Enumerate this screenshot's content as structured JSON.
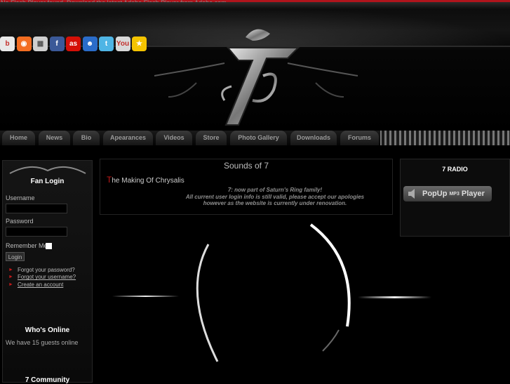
{
  "flash_notice": "No Flash Player found. Download the latest Adobe Flash Player from Adobe.com",
  "social_icons": [
    {
      "name": "blogger",
      "glyph": "b",
      "color": "#e8e8e8",
      "fg": "#c4302b"
    },
    {
      "name": "blog",
      "glyph": "◉",
      "color": "#f36d21",
      "fg": "#fff"
    },
    {
      "name": "delicious",
      "glyph": "▦",
      "color": "#cfcfcf",
      "fg": "#555"
    },
    {
      "name": "facebook",
      "glyph": "f",
      "color": "#3b5998",
      "fg": "#fff"
    },
    {
      "name": "lastfm",
      "glyph": "as",
      "color": "#d51007",
      "fg": "#fff"
    },
    {
      "name": "myspace",
      "glyph": "☻",
      "color": "#2a6cc9",
      "fg": "#fff"
    },
    {
      "name": "twitter",
      "glyph": "t",
      "color": "#4fb5e5",
      "fg": "#fff"
    },
    {
      "name": "youtube",
      "glyph": "You",
      "color": "#d9d9d9",
      "fg": "#c4302b"
    },
    {
      "name": "favorite",
      "glyph": "★",
      "color": "#f5c400",
      "fg": "#fff"
    }
  ],
  "nav": [
    "Home",
    "News",
    "Bio",
    "Apearances",
    "Videos",
    "Store",
    "Photo Gallery",
    "Downloads",
    "Forums"
  ],
  "login": {
    "title": "Fan Login",
    "username_label": "Username",
    "password_label": "Password",
    "remember_label": "Remember Me",
    "button": "Login",
    "links": [
      "Forgot your password?",
      "Forgot your username?",
      "Create an account"
    ]
  },
  "whos_online": {
    "title": "Who's Online",
    "text": "We have 15 guests online"
  },
  "community_title": "7 Community",
  "center": {
    "title": "Sounds of 7",
    "article_first": "T",
    "article_rest": "he Making Of Chrysalis",
    "notice": [
      "7: now part of Saturn's Ring family!",
      "All current user login info is still valid, please accept our apologies",
      "however as the website is currently under renovation."
    ]
  },
  "radio": {
    "title": "7 RADIO",
    "popup_main": "PopUp",
    "popup_small": "MP3",
    "popup_end": "Player"
  },
  "colors": {
    "accent_red": "#c41a1a",
    "background": "#000000"
  }
}
